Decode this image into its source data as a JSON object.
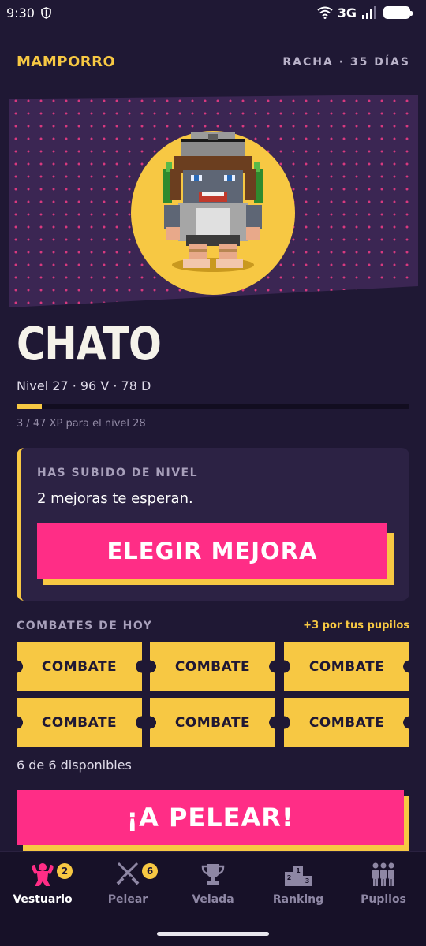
{
  "status_bar": {
    "time": "9:30",
    "network": "3G"
  },
  "header": {
    "brand": "MAMPORRO",
    "streak": "RACHA · 35 DÍAS"
  },
  "fighter": {
    "name": "CHATO",
    "stats": "Nivel 27 · 96 V · 78 D",
    "xp_text": "3 / 47 XP para el nivel 28",
    "xp_fraction": 0.064
  },
  "level_up": {
    "label": "HAS SUBIDO DE NIVEL",
    "text": "2 mejoras te esperan.",
    "button": "ELEGIR MEJORA"
  },
  "fights": {
    "title": "COMBATES DE HOY",
    "bonus": "+3 por tus pupilos",
    "tickets": [
      "COMBATE",
      "COMBATE",
      "COMBATE",
      "COMBATE",
      "COMBATE",
      "COMBATE"
    ],
    "available": "6 de 6 disponibles",
    "fight_button": "¡A PELEAR!"
  },
  "nav": {
    "items": [
      {
        "label": "Vestuario",
        "icon": "flexing-strongman-icon",
        "badge": "2",
        "active": true
      },
      {
        "label": "Pelear",
        "icon": "crossed-swords-icon",
        "badge": "6",
        "active": false
      },
      {
        "label": "Velada",
        "icon": "trophy-icon",
        "badge": "",
        "active": false
      },
      {
        "label": "Ranking",
        "icon": "podium-icon",
        "badge": "",
        "active": false
      },
      {
        "label": "Pupilos",
        "icon": "group-icon",
        "badge": "",
        "active": false
      }
    ]
  },
  "colors": {
    "accent": "#f7c843",
    "primary": "#ff2d86",
    "background": "#1f1834",
    "card": "#2c2244"
  }
}
